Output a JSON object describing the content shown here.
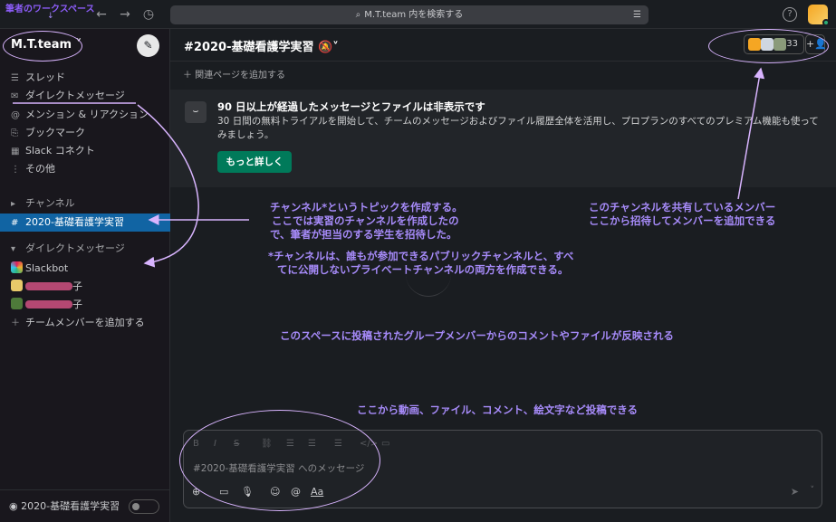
{
  "annotations": {
    "workspace": "筆者のワークスペース",
    "channel_topic": [
      "チャンネル*というトピックを作成する。",
      "ここでは実習のチャンネルを作成したの",
      "で、筆者が担当のする学生を招待した。"
    ],
    "channel_note": [
      "*チャンネルは、誰もが参加できるパブリックチャンネルと、すべ",
      "てに公開しないプライベートチャンネルの両方を作成できる。"
    ],
    "members": [
      "このチャンネルを共有しているメンバー",
      "ここから招待してメンバーを追加できる"
    ],
    "space": "このスペースに投稿されたグループメンバーからのコメントやファイルが反映される",
    "composer": "ここから動画、ファイル、コメント、絵文字など投稿できる"
  },
  "search": {
    "placeholder": "M.T.team 内を検索する"
  },
  "workspace": {
    "name": "M.T.team ˅"
  },
  "sidebar": {
    "items": [
      {
        "icon": "thread-icon",
        "glyph": "☰",
        "label": "スレッド"
      },
      {
        "icon": "dm-icon",
        "glyph": "✉",
        "label": "ダイレクトメッセージ"
      },
      {
        "icon": "mention-icon",
        "glyph": "@",
        "label": "メンション & リアクション"
      },
      {
        "icon": "bookmark-icon",
        "glyph": "⎘",
        "label": "ブックマーク"
      },
      {
        "icon": "connect-icon",
        "glyph": "▦",
        "label": "Slack コネクト"
      },
      {
        "icon": "more-icon",
        "glyph": "⋮",
        "label": "その他"
      }
    ],
    "channels_section": "チャンネル",
    "active_channel": "2020-基礎看護学実習",
    "dm_section": "ダイレクトメッセージ",
    "dms": [
      {
        "label": "Slackbot"
      },
      {
        "label": "子"
      },
      {
        "label": "子"
      }
    ],
    "add_member": "チームメンバーを追加する",
    "huddle": "2020-基礎看護学実習"
  },
  "channel": {
    "title": "#2020-基礎看護学実習",
    "member_count": "33",
    "bookmark": "＋ 関連ページを追加する"
  },
  "notice": {
    "title": "90 日以上が経過したメッセージとファイルは非表示です",
    "body": "30 日間の無料トライアルを開始して、チームのメッセージおよびファイル履歴全体を活用し、プロプランのすべてのプレミアム機能も使ってみましょう。",
    "button": "もっと詳しく"
  },
  "composer": {
    "placeholder": "#2020-基礎看護学実習 へのメッセージ"
  },
  "colors": {
    "accent": "#1164a3",
    "annotation": "#a78bfa",
    "button": "#007a5a"
  }
}
